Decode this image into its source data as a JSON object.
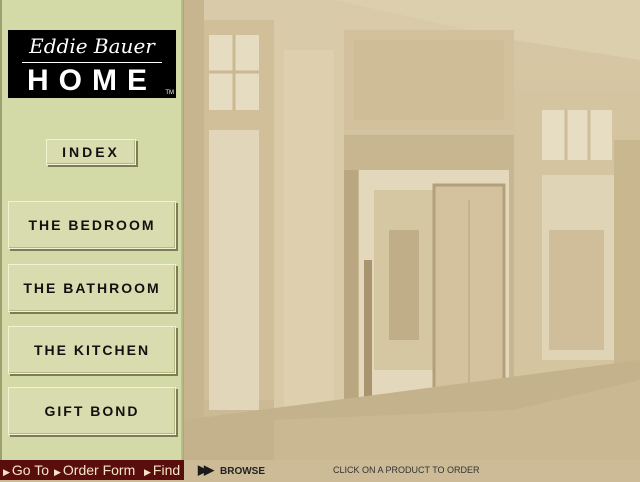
{
  "logo": {
    "script": "Eddie Bauer",
    "word": "HOME",
    "tm": "TM"
  },
  "sidebar": {
    "index_label": "INDEX",
    "rooms": [
      {
        "label": "THE BEDROOM"
      },
      {
        "label": "THE BATHROOM"
      },
      {
        "label": "THE KITCHEN"
      },
      {
        "label": "GIFT BOND"
      }
    ]
  },
  "navbar": {
    "goto": "Go To",
    "order_form": "Order Form",
    "find": "Find"
  },
  "browse_label": "BROWSE",
  "hint": "CLICK ON A PRODUCT TO ORDER",
  "colors": {
    "sidebar_bg": "#d4d9a8",
    "navbar_bg": "#5a0d0d",
    "scene_tone": "#d2c19d"
  }
}
